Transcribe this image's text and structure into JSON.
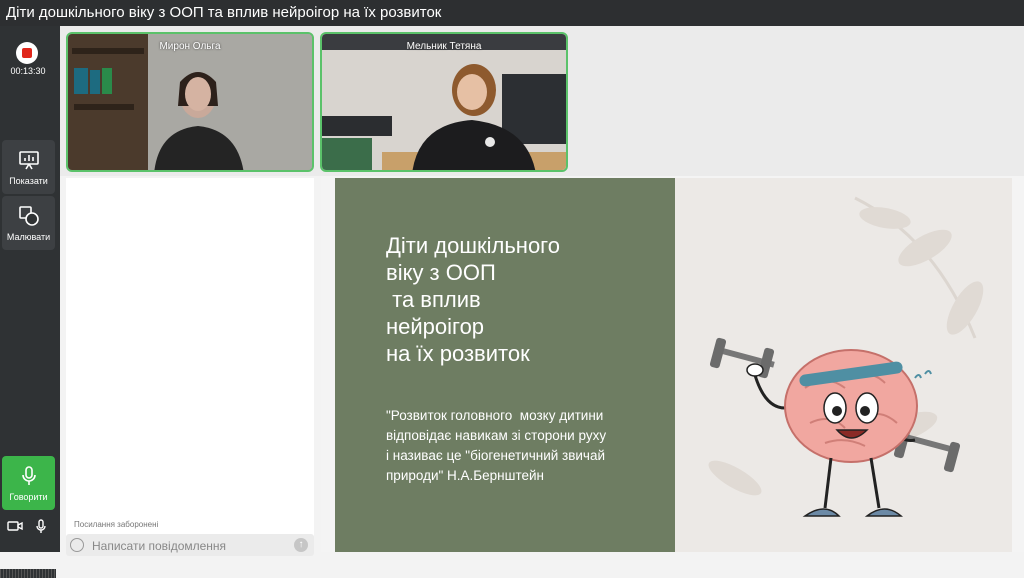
{
  "window": {
    "title": "Діти дошкільного віку з ООП та вплив нейроігор на їх розвиток"
  },
  "sidebar": {
    "record_time": "00:13:30",
    "present_label": "Показати",
    "draw_label": "Малювати",
    "speak_label": "Говорити"
  },
  "participants": [
    {
      "name": "Мирон Ольга"
    },
    {
      "name": "Мельник Тетяна"
    }
  ],
  "chat": {
    "links_notice": "Посилання заборонені",
    "placeholder": "Написати повідомлення"
  },
  "slide": {
    "title": "Діти дошкільного\nвіку з ООП\n та вплив\nнейроігор\nна їх розвиток",
    "quote": "\"Розвиток головного  мозку дитини\nвідповідає навикам зі сторони руху\nі називає це \"біогенетичний звичай\nприроди\" Н.А.Бернштейн"
  },
  "colors": {
    "accent_green": "#3cb54a",
    "slide_green": "#6e7d62",
    "record_red": "#e0261b",
    "sidebar_bg": "#2f3234"
  }
}
